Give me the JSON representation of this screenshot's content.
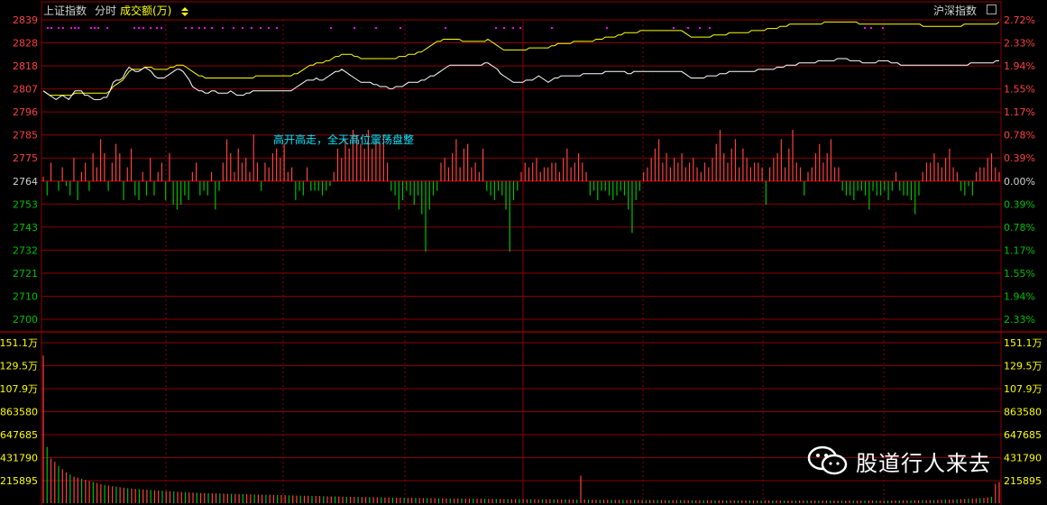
{
  "header": {
    "index_name": "上证指数",
    "mode_label": "分时",
    "metric_label": "成交额(万)",
    "toggle_icon": "up-down-arrow-icon",
    "right_label": "沪深指数",
    "end_icon": "square-icon"
  },
  "watermark": {
    "text": "股道行人来去",
    "icon": "wechat-icon"
  },
  "colors": {
    "background": "#000000",
    "grid": "#8b0000",
    "up": "#ff4040",
    "down": "#00c000",
    "price_line": "#ffffff",
    "avg_line": "#ffff00",
    "dots": "#ff00ff",
    "annotation": "#00e5ff",
    "left_label": "#ff4040",
    "left_label_lower": "#00c000",
    "volume_label": "#ffff00"
  },
  "chart_data": {
    "type": "line",
    "price_axis": {
      "ticks": [
        "2839",
        "2828",
        "2818",
        "2807",
        "2796",
        "2785",
        "2775",
        "2764",
        "2753",
        "2743",
        "2732",
        "2721",
        "2710",
        "2700"
      ],
      "pct_ticks": [
        "2.72%",
        "2.33%",
        "1.94%",
        "1.55%",
        "1.17%",
        "0.78%",
        "0.39%",
        "0.00%",
        "0.39%",
        "0.78%",
        "1.17%",
        "1.55%",
        "1.94%",
        "2.33%"
      ],
      "prev_close": 2764,
      "ylim": [
        2700,
        2839
      ]
    },
    "volume_axis": {
      "ticks": [
        "151.1万",
        "129.5万",
        "107.9万",
        "863580",
        "647685",
        "431790",
        "215895"
      ],
      "ylim": [
        0,
        1511000
      ]
    },
    "annotation": "高开高走，全天高位震荡盘整",
    "price_series": [
      2806,
      2805,
      2804,
      2803,
      2802,
      2803,
      2804,
      2803,
      2802,
      2804,
      2806,
      2806,
      2806,
      2804,
      2804,
      2803,
      2802,
      2802,
      2802,
      2803,
      2803,
      2806,
      2810,
      2811,
      2811,
      2812,
      2815,
      2817,
      2816,
      2815,
      2815,
      2816,
      2817,
      2816,
      2815,
      2813,
      2812,
      2812,
      2812,
      2813,
      2814,
      2815,
      2816,
      2816,
      2815,
      2813,
      2811,
      2808,
      2807,
      2806,
      2806,
      2805,
      2805,
      2806,
      2806,
      2805,
      2805,
      2805,
      2805,
      2806,
      2805,
      2804,
      2804,
      2804,
      2805,
      2805,
      2806,
      2806,
      2806,
      2806,
      2806,
      2806,
      2806,
      2806,
      2806,
      2806,
      2806,
      2806,
      2806,
      2807,
      2808,
      2809,
      2810,
      2811,
      2811,
      2811,
      2812,
      2811,
      2811,
      2812,
      2813,
      2814,
      2815,
      2815,
      2816,
      2815,
      2814,
      2813,
      2812,
      2811,
      2810,
      2810,
      2810,
      2810,
      2809,
      2809,
      2808,
      2808,
      2808,
      2807,
      2807,
      2808,
      2808,
      2808,
      2809,
      2810,
      2810,
      2810,
      2810,
      2811,
      2811,
      2812,
      2813,
      2813,
      2814,
      2815,
      2816,
      2817,
      2818,
      2818,
      2818,
      2818,
      2818,
      2818,
      2818,
      2818,
      2818,
      2818,
      2818,
      2819,
      2819,
      2818,
      2817,
      2816,
      2814,
      2813,
      2812,
      2811,
      2810,
      2810,
      2810,
      2810,
      2811,
      2811,
      2811,
      2812,
      2813,
      2812,
      2811,
      2810,
      2811,
      2812,
      2812,
      2813,
      2813,
      2813,
      2813,
      2813,
      2813,
      2813,
      2814,
      2814,
      2814,
      2814,
      2814,
      2814,
      2814,
      2815,
      2815,
      2815,
      2815,
      2815,
      2815,
      2815,
      2814,
      2814,
      2815,
      2815,
      2815,
      2815,
      2815,
      2815,
      2815,
      2815,
      2815,
      2815,
      2815,
      2815,
      2815,
      2815,
      2815,
      2815,
      2814,
      2813,
      2812,
      2812,
      2812,
      2812,
      2812,
      2813,
      2813,
      2813,
      2813,
      2814,
      2814,
      2814,
      2815,
      2815,
      2815,
      2815,
      2815,
      2815,
      2815,
      2815,
      2815,
      2816,
      2816,
      2816,
      2816,
      2816,
      2816,
      2817,
      2817,
      2817,
      2818,
      2818,
      2818,
      2818,
      2819,
      2819,
      2819,
      2819,
      2819,
      2819,
      2820,
      2820,
      2820,
      2820,
      2820,
      2820,
      2821,
      2821,
      2821,
      2821,
      2820,
      2820,
      2820,
      2820,
      2819,
      2819,
      2819,
      2819,
      2819,
      2820,
      2820,
      2820,
      2820,
      2819,
      2819,
      2819,
      2818,
      2818,
      2818,
      2818,
      2818,
      2818,
      2818,
      2818,
      2818,
      2818,
      2818,
      2818,
      2818,
      2818,
      2818,
      2818,
      2818,
      2818,
      2818,
      2818,
      2818,
      2818,
      2819,
      2819,
      2819,
      2819,
      2819,
      2819,
      2819,
      2819,
      2820,
      2820
    ],
    "avg_series": [
      2806,
      2805,
      2804,
      2804,
      2804,
      2804,
      2804,
      2804,
      2804,
      2804,
      2805,
      2805,
      2805,
      2805,
      2805,
      2805,
      2805,
      2805,
      2805,
      2805,
      2805,
      2806,
      2808,
      2809,
      2810,
      2811,
      2813,
      2815,
      2816,
      2816,
      2816,
      2816,
      2817,
      2817,
      2817,
      2816,
      2816,
      2816,
      2816,
      2816,
      2817,
      2817,
      2818,
      2818,
      2818,
      2817,
      2816,
      2815,
      2814,
      2813,
      2813,
      2812,
      2812,
      2812,
      2812,
      2812,
      2812,
      2812,
      2812,
      2812,
      2812,
      2812,
      2812,
      2812,
      2812,
      2812,
      2812,
      2813,
      2813,
      2813,
      2813,
      2813,
      2813,
      2813,
      2813,
      2813,
      2813,
      2813,
      2813,
      2814,
      2814,
      2815,
      2816,
      2817,
      2818,
      2818,
      2819,
      2819,
      2819,
      2820,
      2820,
      2821,
      2822,
      2822,
      2823,
      2823,
      2823,
      2823,
      2822,
      2822,
      2821,
      2821,
      2821,
      2821,
      2821,
      2821,
      2821,
      2821,
      2821,
      2821,
      2821,
      2821,
      2822,
      2822,
      2822,
      2823,
      2823,
      2823,
      2824,
      2824,
      2825,
      2826,
      2827,
      2828,
      2829,
      2829,
      2830,
      2830,
      2830,
      2830,
      2830,
      2830,
      2829,
      2829,
      2829,
      2829,
      2829,
      2829,
      2829,
      2829,
      2830,
      2829,
      2828,
      2827,
      2826,
      2825,
      2825,
      2825,
      2825,
      2825,
      2825,
      2825,
      2825,
      2826,
      2826,
      2826,
      2826,
      2826,
      2826,
      2826,
      2827,
      2827,
      2828,
      2828,
      2828,
      2828,
      2828,
      2829,
      2829,
      2829,
      2829,
      2829,
      2829,
      2829,
      2830,
      2830,
      2830,
      2831,
      2831,
      2831,
      2831,
      2832,
      2832,
      2833,
      2833,
      2833,
      2833,
      2833,
      2834,
      2834,
      2834,
      2834,
      2834,
      2834,
      2834,
      2834,
      2834,
      2834,
      2834,
      2834,
      2834,
      2834,
      2833,
      2832,
      2831,
      2831,
      2831,
      2831,
      2831,
      2831,
      2831,
      2832,
      2832,
      2832,
      2832,
      2832,
      2833,
      2833,
      2833,
      2833,
      2833,
      2833,
      2833,
      2834,
      2834,
      2834,
      2834,
      2834,
      2835,
      2835,
      2835,
      2835,
      2836,
      2836,
      2836,
      2837,
      2837,
      2837,
      2837,
      2837,
      2837,
      2837,
      2837,
      2837,
      2837,
      2837,
      2838,
      2838,
      2838,
      2838,
      2838,
      2838,
      2838,
      2838,
      2838,
      2838,
      2838,
      2837,
      2837,
      2837,
      2837,
      2837,
      2837,
      2837,
      2837,
      2837,
      2837,
      2837,
      2837,
      2837,
      2837,
      2837,
      2837,
      2837,
      2837,
      2837,
      2837,
      2836,
      2836,
      2836,
      2836,
      2836,
      2836,
      2836,
      2836,
      2836,
      2836,
      2836,
      2836,
      2836,
      2837,
      2837,
      2837,
      2837,
      2837,
      2837,
      2837,
      2837,
      2837,
      2837,
      2837,
      2838
    ],
    "strength_bars": [
      1,
      -3,
      4,
      0,
      -2,
      3,
      -1,
      -3,
      5,
      -4,
      2,
      4,
      -2,
      6,
      3,
      9,
      6,
      -2,
      4,
      8,
      6,
      -4,
      3,
      7,
      -3,
      -4,
      2,
      -3,
      5,
      -3,
      2,
      4,
      -4,
      6,
      -5,
      -6,
      -5,
      -3,
      -4,
      2,
      4,
      -3,
      -2,
      -3,
      2,
      -6,
      -2,
      4,
      9,
      6,
      2,
      7,
      4,
      5,
      2,
      10,
      4,
      -2,
      4,
      3,
      6,
      7,
      5,
      8,
      2,
      3,
      -4,
      -2,
      -3,
      3,
      -2,
      -2,
      -2,
      -3,
      -2,
      -1,
      2,
      7,
      5,
      9,
      7,
      11,
      10,
      8,
      7,
      11,
      7,
      9,
      8,
      10,
      4,
      -2,
      -3,
      -6,
      -4,
      -2,
      -3,
      -5,
      -3,
      -7,
      -15,
      -6,
      -3,
      -2,
      4,
      5,
      3,
      6,
      9,
      3,
      7,
      8,
      3,
      4,
      2,
      7,
      -2,
      -3,
      -4,
      -2,
      -3,
      -6,
      -15,
      -4,
      -2,
      2,
      4,
      3,
      4,
      5,
      2,
      3,
      3,
      4,
      4,
      2,
      5,
      7,
      3,
      4,
      6,
      4,
      2,
      -3,
      -2,
      -4,
      -2,
      -2,
      -3,
      -4,
      -3,
      -2,
      -3,
      -6,
      -11,
      -4,
      -2,
      2,
      3,
      5,
      7,
      9,
      4,
      6,
      3,
      5,
      4,
      6,
      3,
      4,
      5,
      3,
      2,
      4,
      3,
      5,
      8,
      11,
      6,
      4,
      7,
      9,
      3,
      7,
      5,
      3,
      4,
      4,
      3,
      -5,
      3,
      5,
      6,
      9,
      3,
      7,
      11,
      4,
      3,
      -3,
      2,
      3,
      6,
      8,
      4,
      6,
      9,
      3,
      3,
      -2,
      -3,
      -3,
      -4,
      -2,
      -2,
      -3,
      -6,
      -2,
      -3,
      -3,
      -2,
      -4,
      -2,
      2,
      -2,
      -3,
      -3,
      -4,
      -7,
      -3,
      2,
      4,
      4,
      6,
      4,
      3,
      5,
      7,
      3,
      2,
      -2,
      -3,
      -1,
      -3,
      2,
      3,
      3,
      5,
      6,
      3,
      2
    ],
    "volume_series": [
      1390000,
      530000,
      420000,
      390000,
      350000,
      320000,
      290000,
      270000,
      250000,
      240000,
      230000,
      220000,
      210000,
      200000,
      190000,
      180000,
      170000,
      165000,
      160000,
      155000,
      150000,
      145000,
      140000,
      138000,
      135000,
      132000,
      130000,
      128000,
      125000,
      122000,
      120000,
      118000,
      115000,
      113000,
      110000,
      108000,
      106000,
      104000,
      102000,
      100000,
      98000,
      96000,
      95000,
      94000,
      93000,
      92000,
      91000,
      90000,
      89000,
      88000,
      87000,
      86000,
      85000,
      84000,
      83000,
      82000,
      81000,
      80000,
      80000,
      79000,
      78000,
      77000,
      76000,
      75000,
      74000,
      73000,
      72000,
      71000,
      70000,
      70000,
      69000,
      68000,
      67000,
      66000,
      65000,
      64000,
      64000,
      63000,
      62000,
      61000,
      60000,
      60000,
      59000,
      58000,
      57000,
      57000,
      56000,
      55000,
      55000,
      54000,
      53000,
      53000,
      52000,
      52000,
      51000,
      50000,
      50000,
      49000,
      49000,
      48000,
      48000,
      47000,
      47000,
      46000,
      46000,
      45000,
      45000,
      44000,
      44000,
      44000,
      43000,
      43000,
      42000,
      42000,
      42000,
      41000,
      41000,
      40000,
      40000,
      40000,
      39000,
      39000,
      39000,
      38000,
      38000,
      38000,
      37000,
      37000,
      37000,
      36000,
      36000,
      36000,
      36000,
      35000,
      35000,
      35000,
      35000,
      34000,
      34000,
      34000,
      260000,
      34000,
      33000,
      33000,
      33000,
      33000,
      32000,
      32000,
      32000,
      32000,
      32000,
      31000,
      31000,
      31000,
      31000,
      31000,
      30000,
      30000,
      30000,
      30000,
      30000,
      30000,
      29000,
      29000,
      29000,
      29000,
      29000,
      29000,
      28000,
      28000,
      28000,
      28000,
      28000,
      28000,
      28000,
      27000,
      27000,
      27000,
      27000,
      27000,
      27000,
      27000,
      27000,
      26000,
      26000,
      26000,
      26000,
      26000,
      26000,
      26000,
      26000,
      26000,
      25000,
      25000,
      25000,
      25000,
      25000,
      25000,
      25000,
      25000,
      25000,
      25000,
      25000,
      25000,
      25000,
      25000,
      25000,
      25000,
      25000,
      25000,
      25000,
      25000,
      25000,
      25000,
      25000,
      25000,
      25000,
      25000,
      25000,
      25000,
      26000,
      26000,
      26000,
      26000,
      27000,
      27000,
      27000,
      28000,
      28000,
      29000,
      29000,
      30000,
      30000,
      31000,
      32000,
      33000,
      34000,
      35000,
      36000,
      38000,
      40000,
      42000,
      44000,
      46000,
      48000,
      50000,
      55000,
      60000,
      180000,
      200000
    ],
    "grid": true
  }
}
